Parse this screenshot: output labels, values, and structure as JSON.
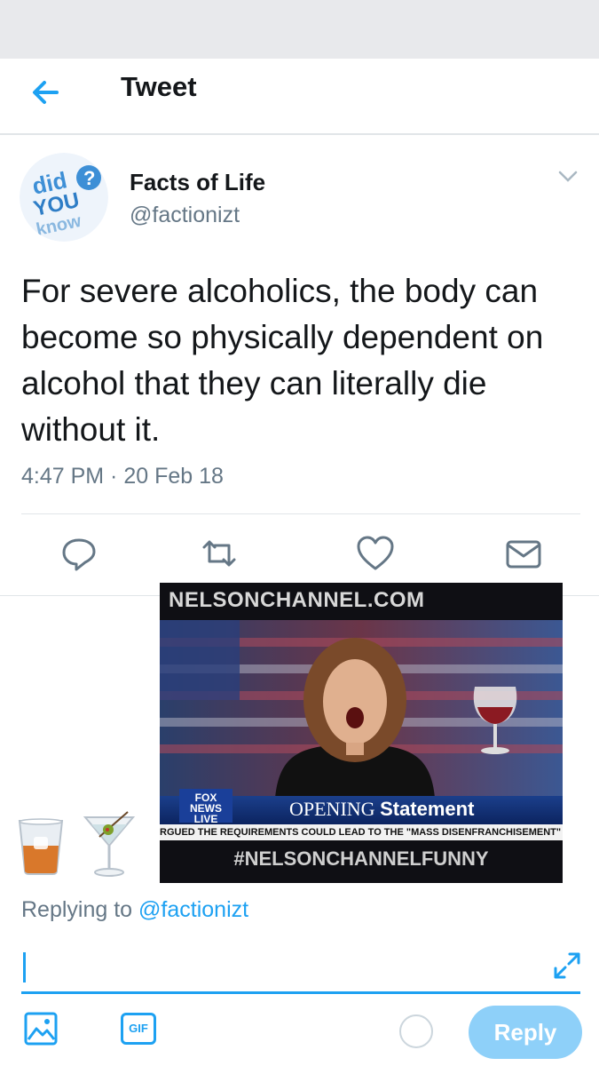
{
  "header": {
    "title": "Tweet"
  },
  "tweet": {
    "author_name": "Facts of Life",
    "author_handle": "@factionizt",
    "avatar_text": [
      "did",
      "YOU",
      "know"
    ],
    "text": "For severe alcoholics, the body can become so physically dependent on alcohol that they can literally die without it.",
    "timestamp": "4:47 PM · 20 Feb 18"
  },
  "actions": [
    "reply-icon",
    "retweet-icon",
    "like-icon",
    "share-icon"
  ],
  "media": {
    "site": "NELSONCHANNEL.COM",
    "lower_third_serif": "OPENING ",
    "lower_third_bold": "Statement",
    "network": "FOX NEWS",
    "live": "LIVE",
    "ticker": "RGUED THE REQUIREMENTS COULD LEAD TO THE \"MASS DISENFRANCHISEMENT\"",
    "hashtag": "#NELSONCHANNELFUNNY"
  },
  "emojis": [
    "tumbler-glass-icon",
    "cocktail-glass-icon"
  ],
  "reply": {
    "prefix": "Replying to ",
    "handle": "@factionizt",
    "button_label": "Reply",
    "gif_label": "GIF"
  },
  "colors": {
    "accent": "#1da1f2",
    "muted": "#657786",
    "reply_button": "#8ed0f9"
  }
}
